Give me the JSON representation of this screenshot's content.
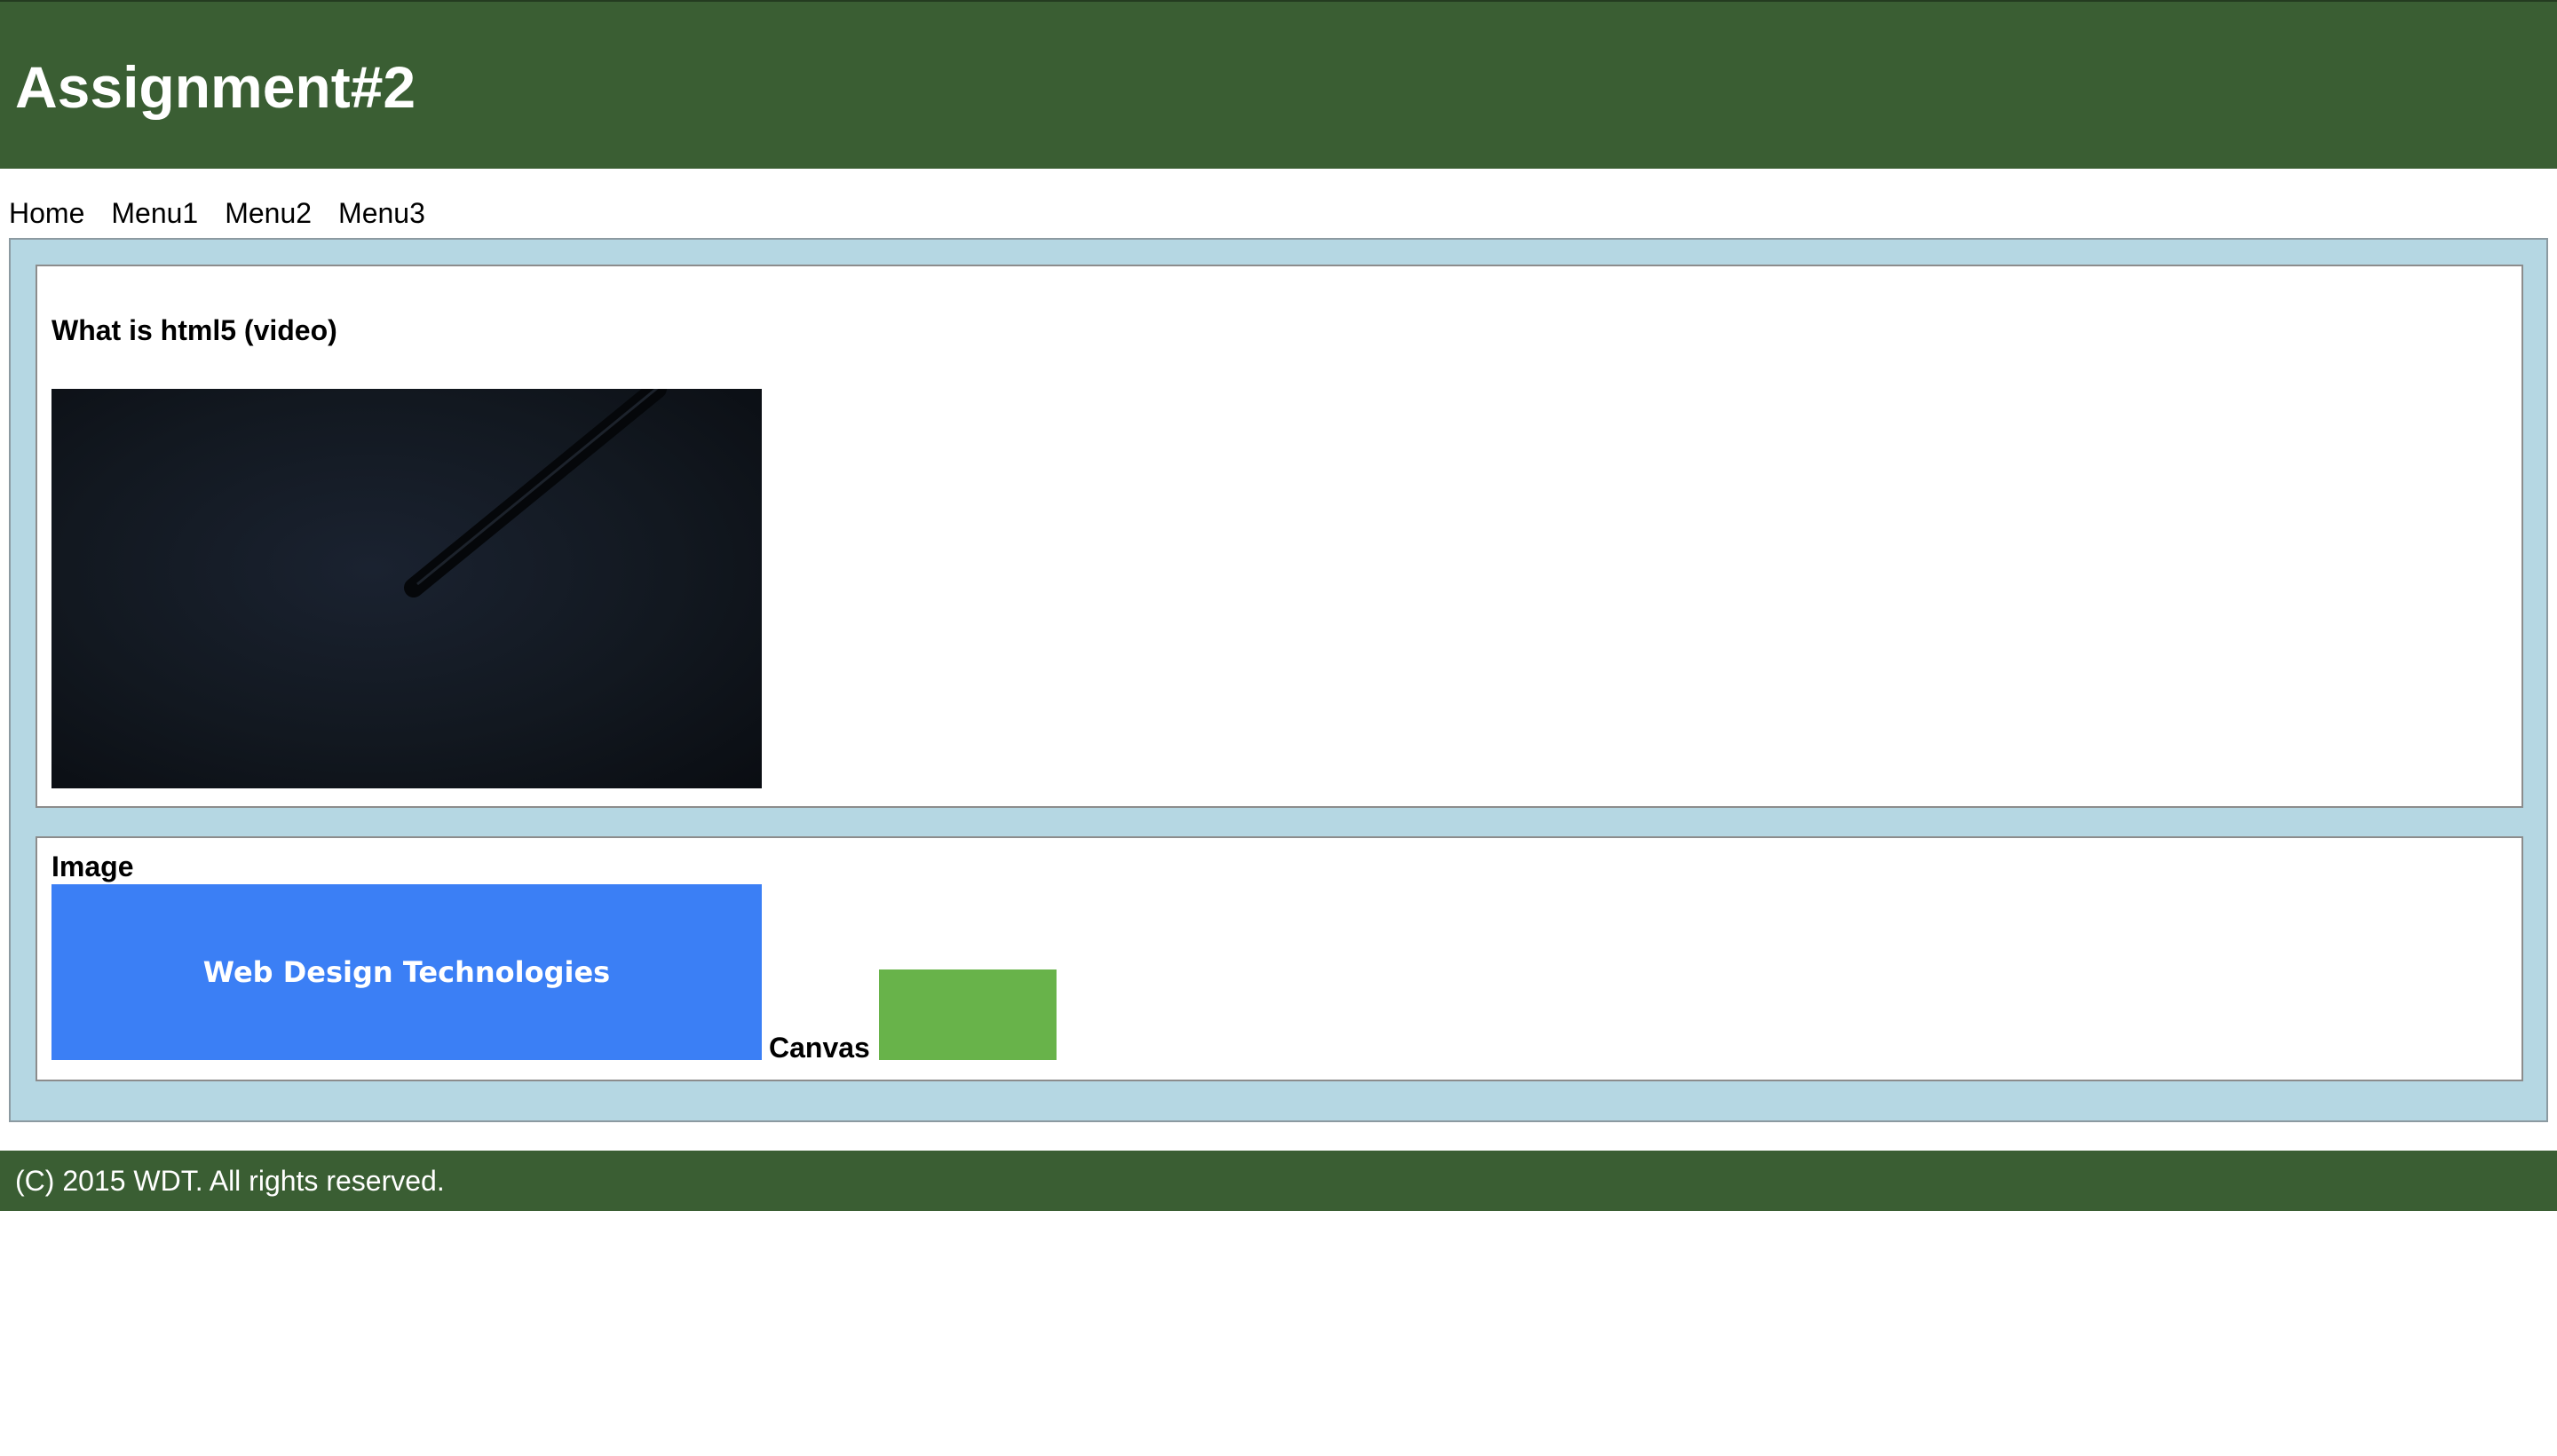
{
  "header": {
    "title": "Assignment#2",
    "background_color": "#3a5e33"
  },
  "nav": {
    "items": [
      {
        "label": "Home"
      },
      {
        "label": "Menu1"
      },
      {
        "label": "Menu2"
      },
      {
        "label": "Menu3"
      }
    ]
  },
  "main": {
    "background_color": "#b5d7e3",
    "video_section": {
      "heading": "What is html5 (video)"
    },
    "media_section": {
      "image_heading": "Image",
      "image_text": "Web Design Technologies",
      "image_color": "#3b7ff5",
      "canvas_label": "Canvas",
      "canvas_fill_color": "#68b34a"
    }
  },
  "footer": {
    "text": "(C) 2015 WDT. All rights reserved."
  }
}
